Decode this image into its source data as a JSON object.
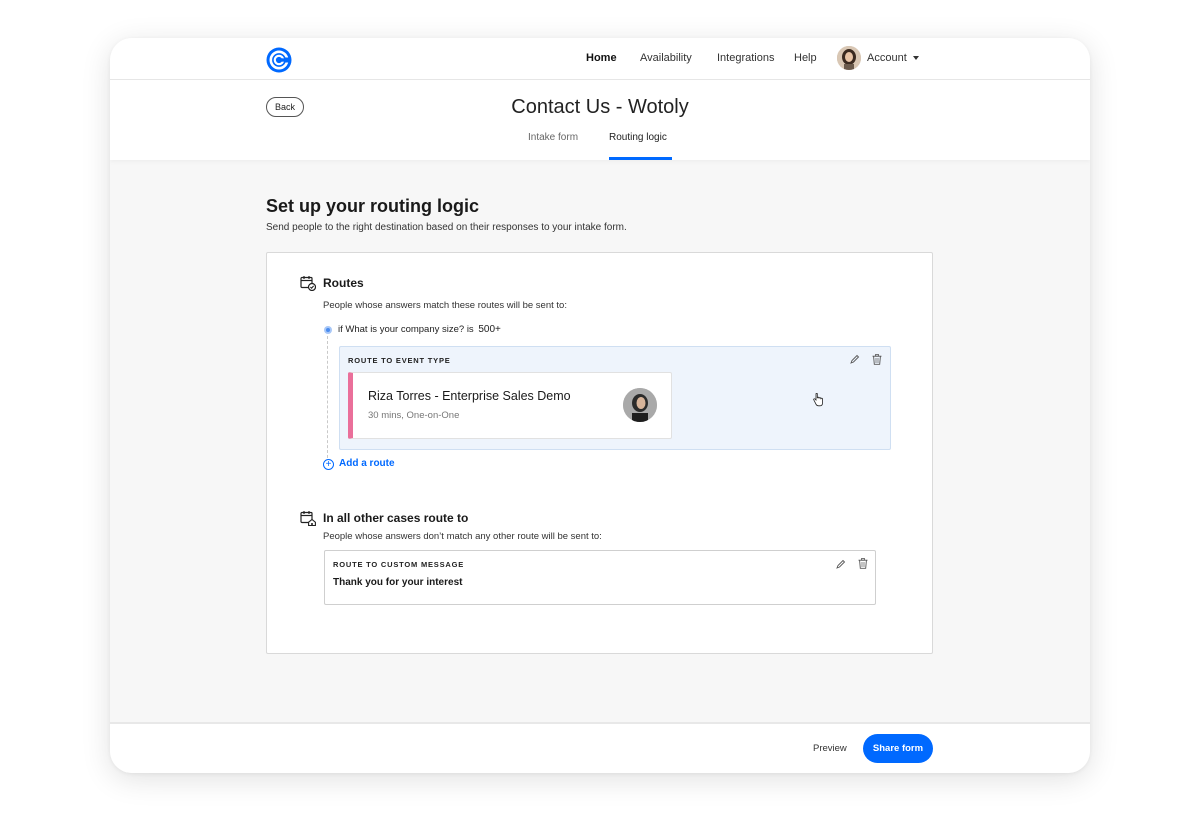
{
  "nav": {
    "items": [
      {
        "label": "Home",
        "active": true
      },
      {
        "label": "Availability"
      },
      {
        "label": "Integrations"
      },
      {
        "label": "Help"
      }
    ],
    "account_label": "Account"
  },
  "header": {
    "back_label": "Back",
    "title": "Contact Us - Wotoly",
    "tabs": [
      {
        "label": "Intake form"
      },
      {
        "label": "Routing logic",
        "active": true
      }
    ]
  },
  "main": {
    "title": "Set up your routing logic",
    "subtitle": "Send people to the right destination based on their responses to your intake form."
  },
  "routes": {
    "title": "Routes",
    "description": "People whose answers match these routes will be sent to:",
    "condition_text": "if What is your company size? is",
    "condition_value": "500+",
    "route_label": "ROUTE TO EVENT TYPE",
    "event": {
      "name": "Riza Torres - Enterprise Sales Demo",
      "meta": "30 mins, One-on-One"
    },
    "add_route_label": "Add a route"
  },
  "fallback": {
    "title": "In all other cases route to",
    "description": "People whose answers don’t match any other route will be sent to:",
    "route_label": "ROUTE TO CUSTOM MESSAGE",
    "message": "Thank you for your interest"
  },
  "footer": {
    "preview_label": "Preview",
    "share_label": "Share form"
  },
  "colors": {
    "accent": "#0069ff",
    "event_stripe": "#ea6f9a",
    "route_bg": "#eef4fc"
  }
}
